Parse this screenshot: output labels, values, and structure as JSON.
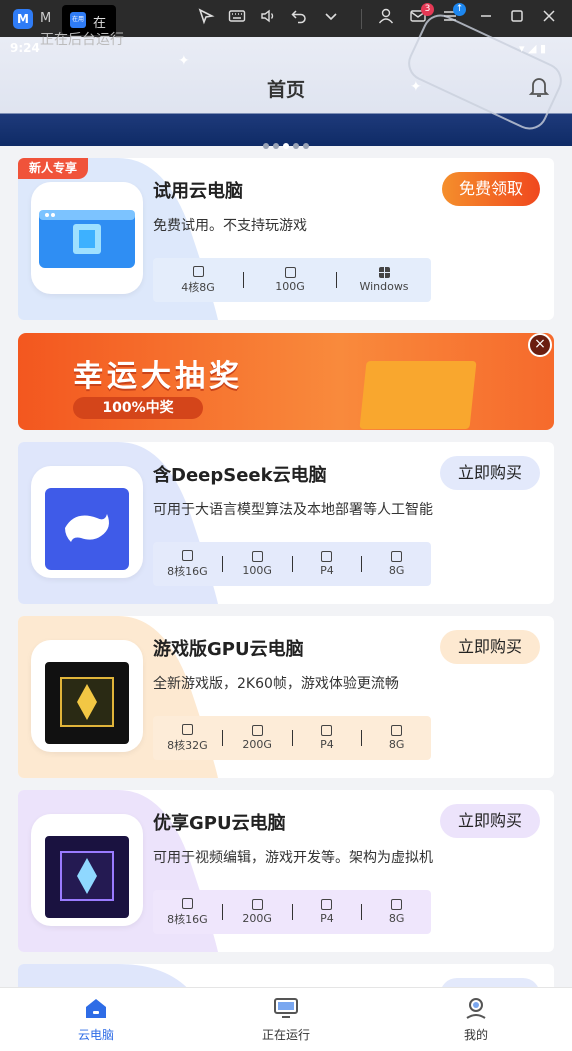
{
  "os_bar": {
    "app_short": "M",
    "tab_label": "在",
    "tab_icon_text": "在用",
    "badges": {
      "mail": "3"
    },
    "icons": [
      "app-icon",
      "cursor-icon",
      "keyboard-icon",
      "volume-icon",
      "undo-icon",
      "chevron-down-icon",
      "user-icon",
      "mail-icon",
      "menu-icon",
      "minimize-icon",
      "maximize-icon",
      "close-icon"
    ]
  },
  "status_bar": {
    "time": "9:24",
    "faded_text": "正在后台运行"
  },
  "header": {
    "title": "首页"
  },
  "carousel": {
    "count": 5,
    "active_index": 2
  },
  "cards": [
    {
      "title": "试用云电脑",
      "desc": "免费试用。不支持玩游戏",
      "button": "免费领取",
      "tag": "新人专享",
      "specs": [
        {
          "icon": "cpu-icon",
          "label": "4核8G"
        },
        {
          "icon": "ssd-icon",
          "label": "100G"
        },
        {
          "icon": "windows-icon",
          "label": "Windows"
        }
      ]
    },
    {
      "title": "含DeepSeek云电脑",
      "desc": "可用于大语言模型算法及本地部署等人工智能",
      "button": "立即购买",
      "specs": [
        {
          "icon": "cpu-icon",
          "label": "8核16G"
        },
        {
          "icon": "ssd-icon",
          "label": "100G"
        },
        {
          "icon": "gpu-icon",
          "label": "P4"
        },
        {
          "icon": "gpu-icon",
          "label": "8G"
        }
      ]
    },
    {
      "title": "游戏版GPU云电脑",
      "desc": "全新游戏版，2K60帧，游戏体验更流畅",
      "button": "立即购买",
      "specs": [
        {
          "icon": "cpu-icon",
          "label": "8核32G"
        },
        {
          "icon": "ssd-icon",
          "label": "200G"
        },
        {
          "icon": "gpu-icon",
          "label": "P4"
        },
        {
          "icon": "gpu-icon",
          "label": "8G"
        }
      ]
    },
    {
      "title": "优享GPU云电脑",
      "desc": "可用于视频编辑，游戏开发等。架构为虚拟机",
      "button": "立即购买",
      "specs": [
        {
          "icon": "cpu-icon",
          "label": "8核16G"
        },
        {
          "icon": "ssd-icon",
          "label": "200G"
        },
        {
          "icon": "gpu-icon",
          "label": "P4"
        },
        {
          "icon": "gpu-icon",
          "label": "8G"
        }
      ]
    }
  ],
  "lottery": {
    "title": "幸运大抽奖",
    "subtitle": "100%中奖"
  },
  "bottom_nav": [
    {
      "label": "云电脑",
      "icon": "home-icon",
      "active": true
    },
    {
      "label": "正在运行",
      "icon": "monitor-icon",
      "active": false
    },
    {
      "label": "我的",
      "icon": "profile-icon",
      "active": false
    }
  ],
  "colors": {
    "accent_blue": "#2e6ce6",
    "free_button": "#f56a1e",
    "purchase_bg_blue": "#e3e9fb",
    "purchase_bg_orange": "#fde9d1",
    "purchase_bg_purple": "#ece3fb"
  }
}
